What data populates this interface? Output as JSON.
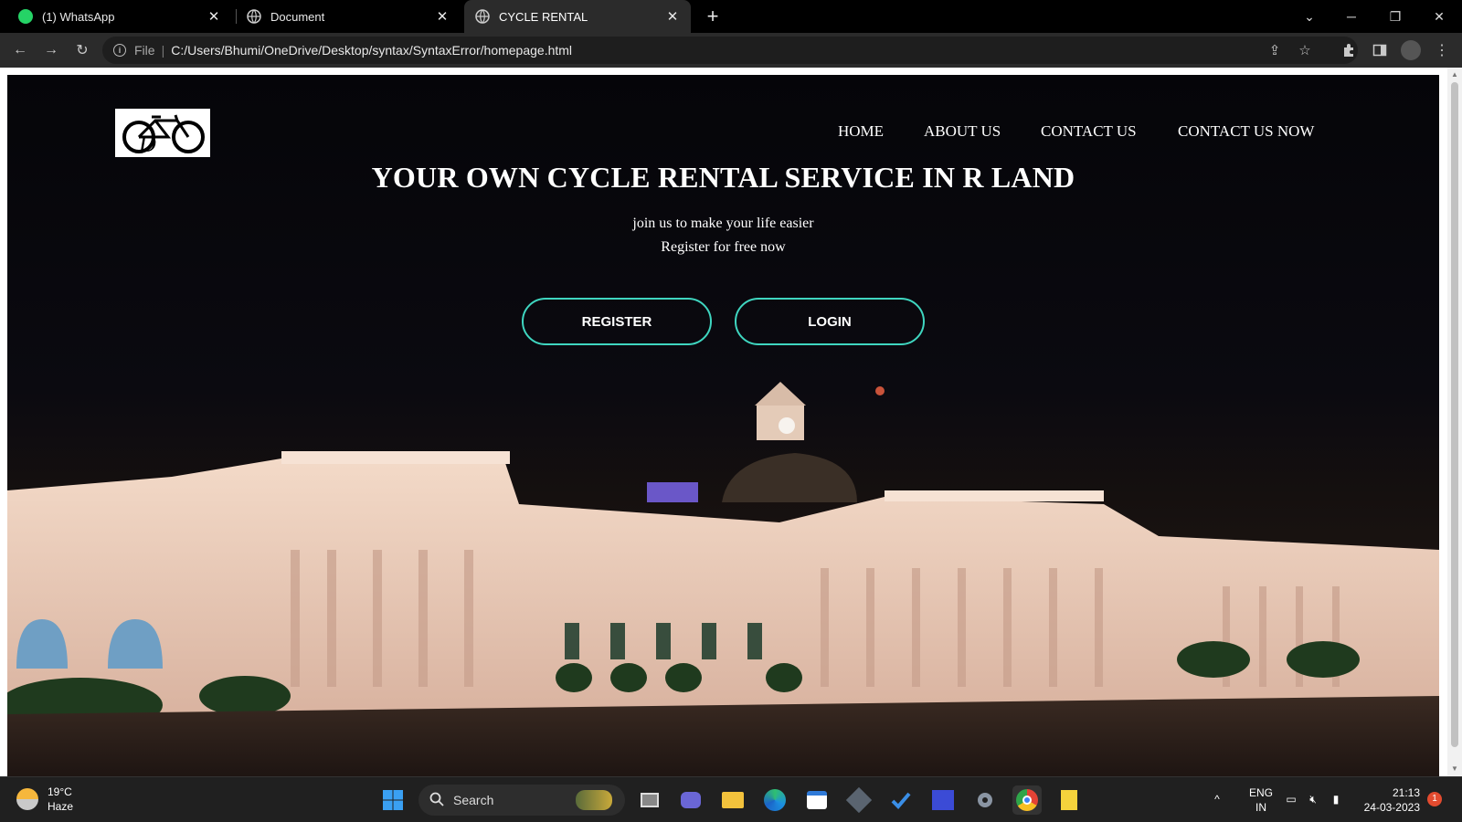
{
  "browser": {
    "tabs": [
      {
        "title": "(1) WhatsApp",
        "favicon": "whatsapp-icon",
        "active": false
      },
      {
        "title": "Document",
        "favicon": "globe-icon",
        "active": false
      },
      {
        "title": "CYCLE RENTAL",
        "favicon": "globe-icon",
        "active": true
      }
    ],
    "omnibox": {
      "scheme_label": "File",
      "url": "C:/Users/Bhumi/OneDrive/Desktop/syntax/SyntaxError/homepage.html"
    }
  },
  "site": {
    "logo": "bicycle-logo",
    "nav": [
      {
        "label": "HOME"
      },
      {
        "label": "ABOUT US"
      },
      {
        "label": "CONTACT US"
      },
      {
        "label": "CONTACT US NOW"
      }
    ],
    "hero": {
      "title": "YOUR OWN CYCLE RENTAL SERVICE IN R LAND",
      "line1": "join us to make your life easier",
      "line2": "Register for free now"
    },
    "buttons": {
      "register": "REGISTER",
      "login": "LOGIN"
    },
    "accent_color": "#3fd6c0"
  },
  "taskbar": {
    "weather": {
      "temp": "19°C",
      "condition": "Haze"
    },
    "search_placeholder": "Search",
    "language": {
      "lang": "ENG",
      "region": "IN"
    },
    "clock": {
      "time": "21:13",
      "date": "24-03-2023"
    },
    "notifications": "1"
  }
}
